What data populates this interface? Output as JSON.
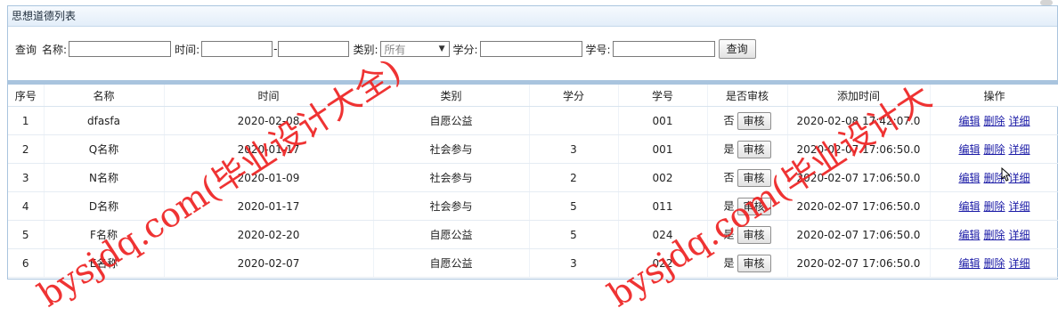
{
  "panel": {
    "title": "思想道德列表"
  },
  "search": {
    "query_label": "查询",
    "name_label": "名称:",
    "name_value": "",
    "time_label": "时间:",
    "time_from": "",
    "time_sep": "-",
    "time_to": "",
    "category_label": "类别:",
    "category_selected": "所有",
    "credit_label": "学分:",
    "credit_value": "",
    "student_no_label": "学号:",
    "student_no_value": "",
    "search_button": "查询"
  },
  "table": {
    "headers": [
      "序号",
      "名称",
      "时间",
      "类别",
      "学分",
      "学号",
      "是否审核",
      "添加时间",
      "操作"
    ],
    "rows": [
      {
        "no": "1",
        "name": "dfasfa",
        "time": "2020-02-08",
        "category": "自愿公益",
        "credit": "",
        "student_no": "001",
        "audited": "否",
        "audit_btn": "审核",
        "added": "2020-02-08 17:42:07.0",
        "edit": "编辑",
        "delete": "删除",
        "detail": "详细"
      },
      {
        "no": "2",
        "name": "Q名称",
        "time": "2020-01-17",
        "category": "社会参与",
        "credit": "3",
        "student_no": "001",
        "audited": "是",
        "audit_btn": "审核",
        "added": "2020-02-07 17:06:50.0",
        "edit": "编辑",
        "delete": "删除",
        "detail": "详细"
      },
      {
        "no": "3",
        "name": "N名称",
        "time": "2020-01-09",
        "category": "社会参与",
        "credit": "2",
        "student_no": "002",
        "audited": "否",
        "audit_btn": "审核",
        "added": "2020-02-07 17:06:50.0",
        "edit": "编辑",
        "delete": "删除",
        "detail": "详细"
      },
      {
        "no": "4",
        "name": "D名称",
        "time": "2020-01-17",
        "category": "社会参与",
        "credit": "5",
        "student_no": "011",
        "audited": "是",
        "audit_btn": "审核",
        "added": "2020-02-07 17:06:50.0",
        "edit": "编辑",
        "delete": "删除",
        "detail": "详细"
      },
      {
        "no": "5",
        "name": "F名称",
        "time": "2020-02-20",
        "category": "自愿公益",
        "credit": "5",
        "student_no": "024",
        "audited": "是",
        "audit_btn": "审核",
        "added": "2020-02-07 17:06:50.0",
        "edit": "编辑",
        "delete": "删除",
        "detail": "详细"
      },
      {
        "no": "6",
        "name": "E名称",
        "time": "2020-02-07",
        "category": "自愿公益",
        "credit": "3",
        "student_no": "022",
        "audited": "是",
        "audit_btn": "审核",
        "added": "2020-02-07 17:06:50.0",
        "edit": "编辑",
        "delete": "删除",
        "detail": "详细"
      }
    ]
  },
  "watermark": {
    "text_left": "bysjdq.com(毕业设计大全)",
    "text_right": "bysjdq.com(毕业设计大",
    "color": "#e22222"
  }
}
